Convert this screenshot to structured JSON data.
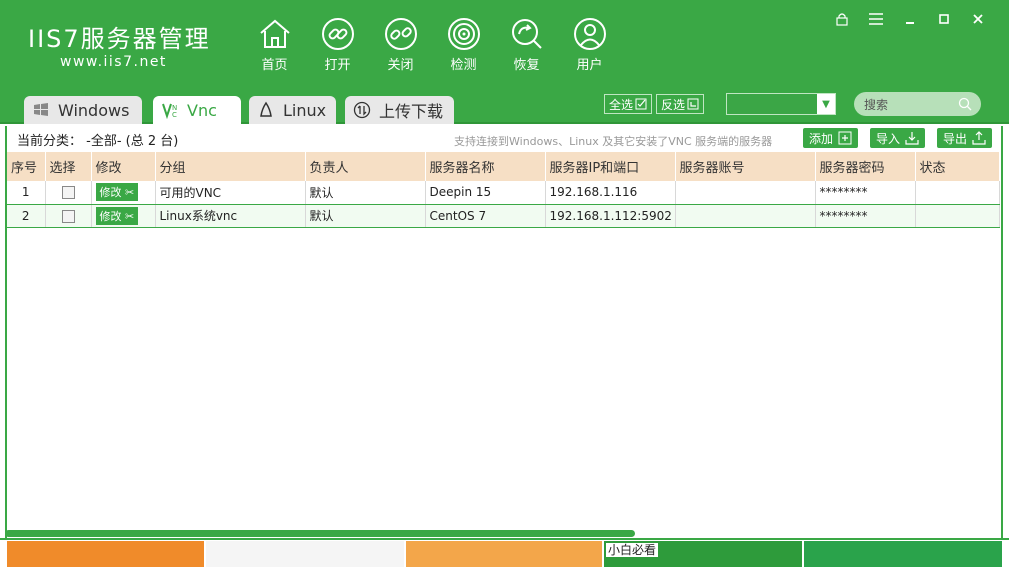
{
  "app": {
    "logo_title": "IIS7服务器管理",
    "logo_url": "www.iis7.net"
  },
  "nav": [
    {
      "label": "首页",
      "icon": "home-icon"
    },
    {
      "label": "打开",
      "icon": "link-icon"
    },
    {
      "label": "关闭",
      "icon": "unlink-icon"
    },
    {
      "label": "检测",
      "icon": "radar-icon"
    },
    {
      "label": "恢复",
      "icon": "restore-icon"
    },
    {
      "label": "用户",
      "icon": "user-icon"
    }
  ],
  "window_controls": [
    "lock-icon",
    "menu-icon",
    "minimize-icon",
    "maximize-icon",
    "close-icon"
  ],
  "tabs": [
    {
      "label": "Windows",
      "icon": "windows-icon",
      "active": false
    },
    {
      "label": "Vnc",
      "icon": "vnc-icon",
      "active": true
    },
    {
      "label": "Linux",
      "icon": "linux-icon",
      "active": false
    },
    {
      "label": "上传下载",
      "icon": "transfer-icon",
      "active": false
    }
  ],
  "toolbar": {
    "select_all": "全选",
    "invert_select": "反选",
    "search_placeholder": "搜索"
  },
  "subbar": {
    "category": "当前分类： -全部- (总 2 台)",
    "hint": "支持连接到Windows、Linux 及其它安装了VNC 服务端的服务器",
    "add": "添加",
    "import": "导入",
    "export": "导出"
  },
  "table": {
    "columns": [
      "序号",
      "选择",
      "修改",
      "分组",
      "负责人",
      "服务器名称",
      "服务器IP和端口",
      "服务器账号",
      "服务器密码",
      "状态"
    ],
    "edit_label": "修改",
    "rows": [
      {
        "index": "1",
        "group": "可用的VNC",
        "owner": "默认",
        "name": "Deepin 15",
        "ip": "192.168.1.116",
        "account": "",
        "password": "********",
        "status": ""
      },
      {
        "index": "2",
        "group": "Linux系统vnc",
        "owner": "默认",
        "name": "CentOS 7",
        "ip": "192.168.1.112:5902",
        "account": "",
        "password": "********",
        "status": ""
      }
    ]
  },
  "banners": {
    "b4_label": "小白必看"
  },
  "colors": {
    "primary": "#3aa845",
    "header_row": "#f6dfc5",
    "alt_row": "#f1fbf1"
  }
}
